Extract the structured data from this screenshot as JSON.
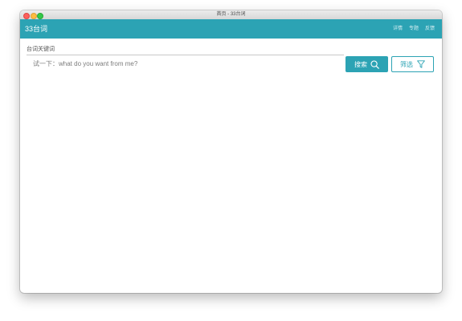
{
  "window": {
    "title": "首页 - 33台词"
  },
  "appbar": {
    "brand": "33台词",
    "nav": [
      "详情",
      "专题",
      "反馈"
    ]
  },
  "search": {
    "label": "台词关键词",
    "placeholder": "试一下：what do you want from me?",
    "value": "",
    "search_label": "搜索",
    "filter_label": "筛选"
  },
  "colors": {
    "accent": "#2ca3b4"
  },
  "icons": {
    "search": "search-icon",
    "filter": "filter-icon"
  }
}
